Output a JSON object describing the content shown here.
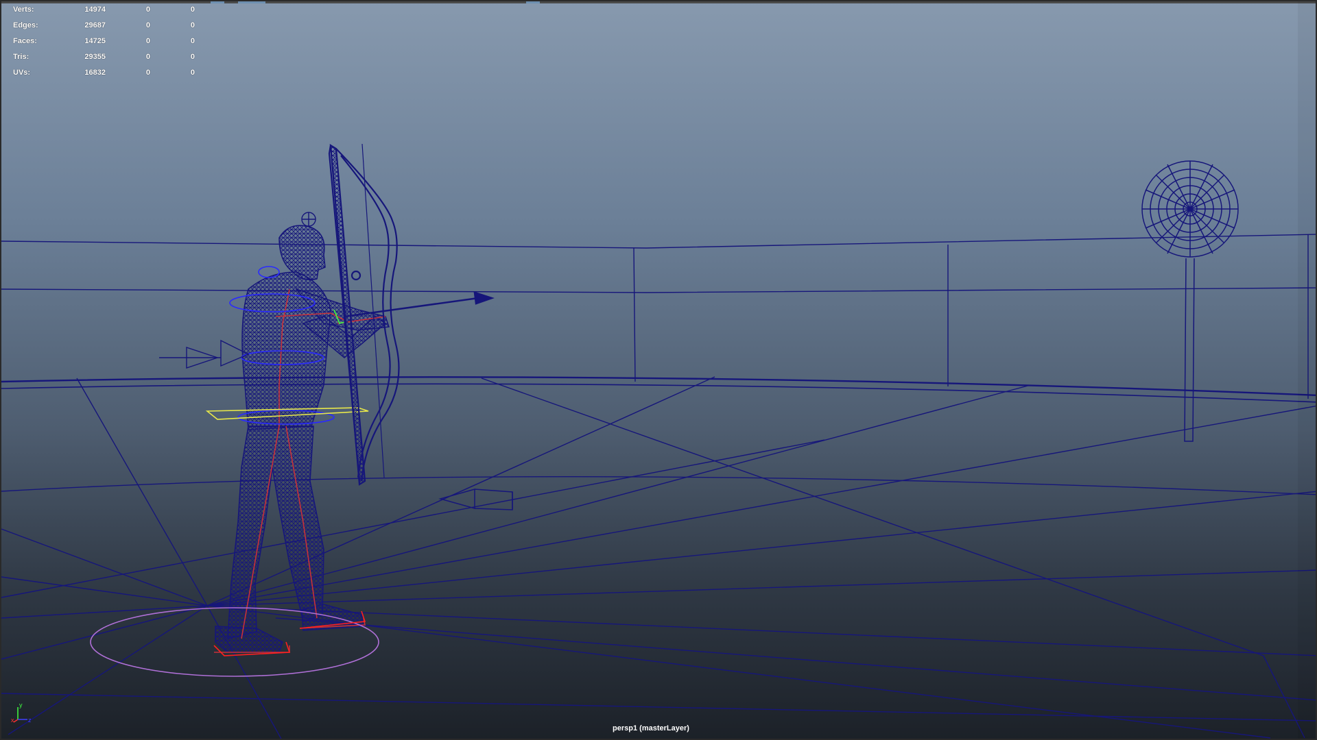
{
  "hud": {
    "rows": [
      {
        "label": "Verts:",
        "v1": "14974",
        "v2": "0",
        "v3": "0"
      },
      {
        "label": "Edges:",
        "v1": "29687",
        "v2": "0",
        "v3": "0"
      },
      {
        "label": "Faces:",
        "v1": "14725",
        "v2": "0",
        "v3": "0"
      },
      {
        "label": "Tris:",
        "v1": "29355",
        "v2": "0",
        "v3": "0"
      },
      {
        "label": "UVs:",
        "v1": "16832",
        "v2": "0",
        "v3": "0"
      }
    ]
  },
  "camera": {
    "label": "persp1 (masterLayer)"
  },
  "axis": {
    "x": "x",
    "y": "y",
    "z": "z"
  },
  "colors": {
    "wireframe": "#16167a",
    "selection": "#e8e84a",
    "joint": "#c8303a",
    "control": "#b070d8",
    "axis_x": "#ff3030",
    "axis_y": "#40ff40",
    "axis_z": "#4040ff"
  }
}
